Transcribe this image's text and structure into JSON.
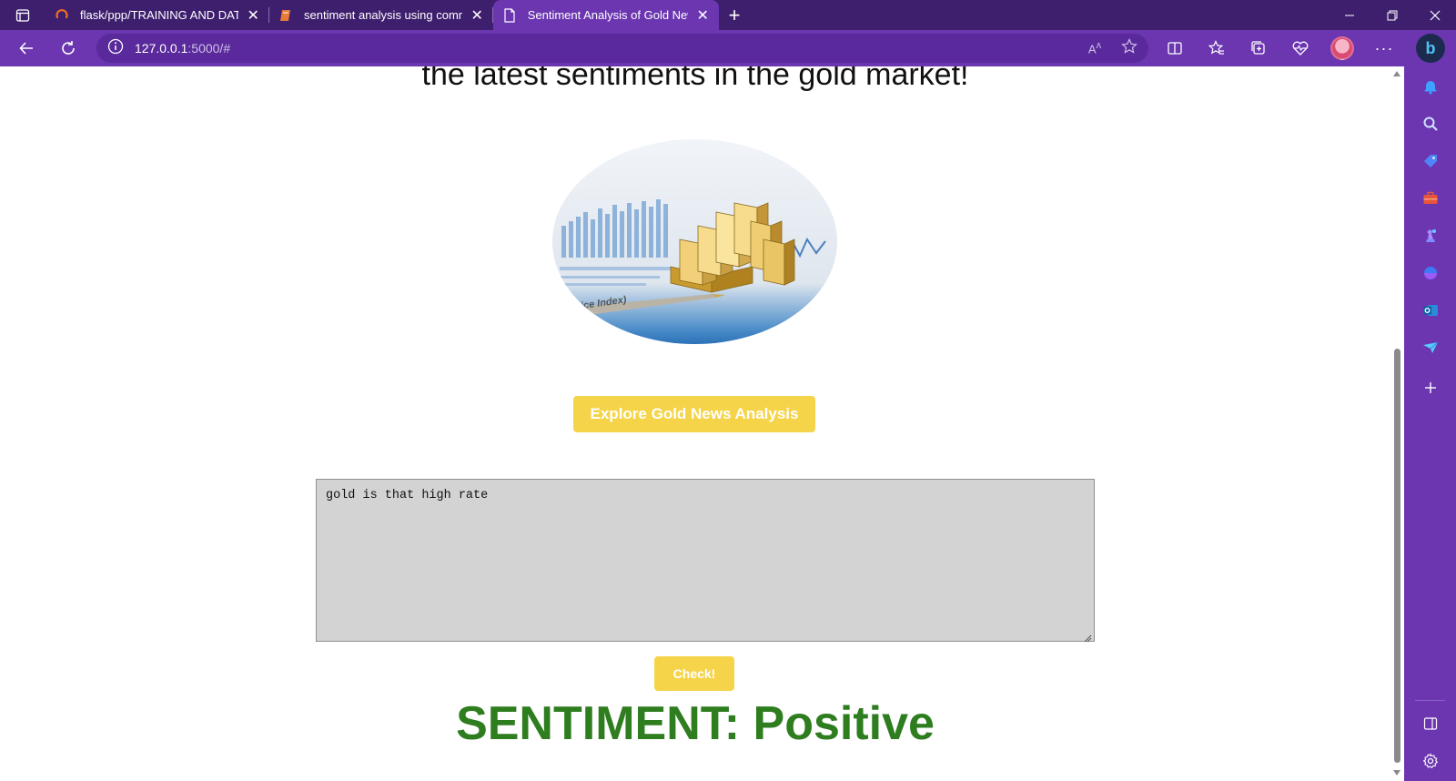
{
  "browser": {
    "tabs": [
      {
        "title": "flask/ppp/TRAINING AND DATAS",
        "active": false,
        "icon": "loading-spinner-icon"
      },
      {
        "title": "sentiment analysis using commo",
        "active": false,
        "icon": "book-icon"
      },
      {
        "title": "Sentiment Analysis of Gold News",
        "active": true,
        "icon": "page-icon"
      }
    ],
    "address": {
      "host": "127.0.0.1",
      "path": ":5000/#"
    },
    "accent_color": "#6b36b0",
    "titlebar_color": "#3e1f6e"
  },
  "page": {
    "hero_heading": "the latest sentiments in the gold market!",
    "image_alt": "Gold bars on financial charts",
    "explore_button": "Explore Gold News Analysis",
    "textarea_value": "gold is that high rate",
    "check_button": "Check!",
    "result_text": "SENTIMENT: Positive",
    "result_color": "#2e7d1f",
    "button_color": "#f6d44a"
  },
  "sidebar": {
    "items": [
      "bell-icon",
      "search-icon",
      "tag-icon",
      "briefcase-icon",
      "chess-icon",
      "copilot-icon",
      "outlook-icon",
      "send-icon",
      "plus-icon"
    ],
    "bottom_items": [
      "split-screen-icon",
      "settings-icon"
    ]
  }
}
